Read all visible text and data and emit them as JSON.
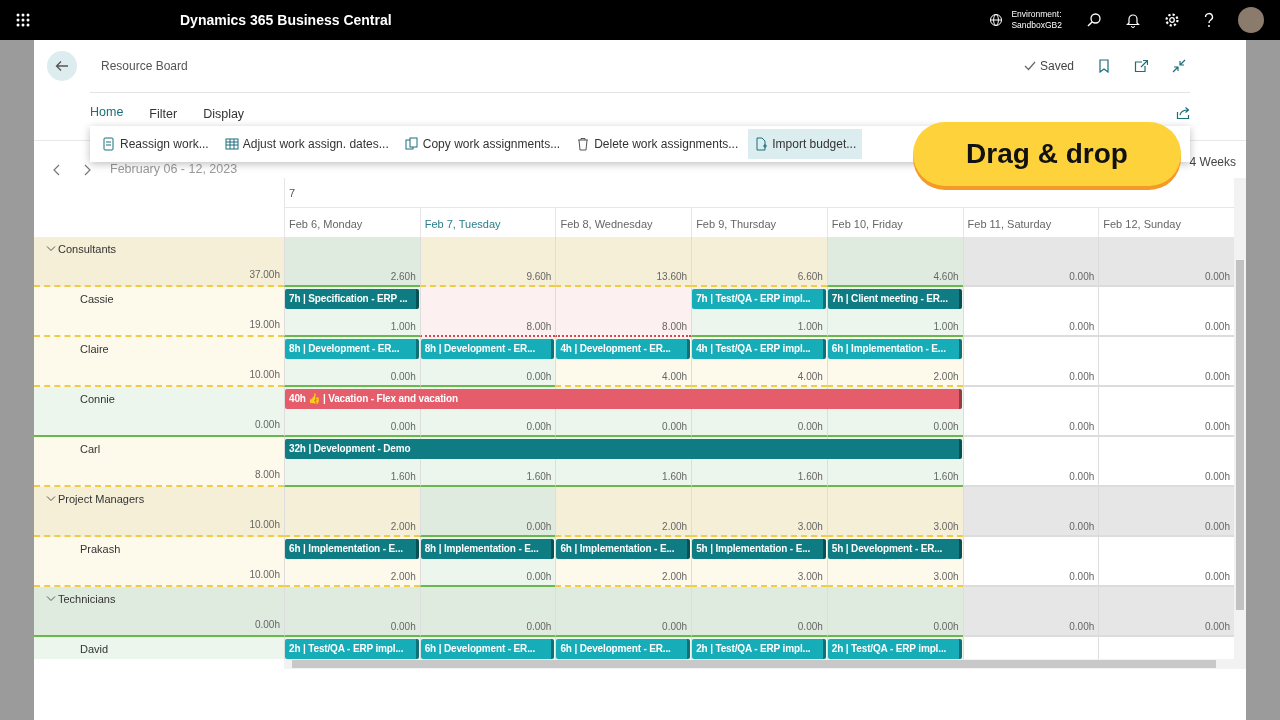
{
  "app": {
    "title": "Dynamics 365 Business Central",
    "environment_label": "Environment:",
    "environment_name": "SandboxGB2"
  },
  "page": {
    "title": "Resource Board",
    "saved": "Saved"
  },
  "tabs": [
    {
      "label": "Home",
      "selected": true
    },
    {
      "label": "Filter",
      "selected": false
    },
    {
      "label": "Display",
      "selected": false
    }
  ],
  "actions": [
    {
      "label": "Reassign work...",
      "kind": "reassign",
      "selected": false
    },
    {
      "label": "Adjust work assign. dates...",
      "kind": "calendar",
      "selected": false
    },
    {
      "label": "Copy work assignments...",
      "kind": "copy",
      "selected": false
    },
    {
      "label": "Delete work assignments...",
      "kind": "delete",
      "selected": false
    },
    {
      "label": "Import budget...",
      "kind": "import",
      "selected": true
    }
  ],
  "date_nav": {
    "range": "February 06 - 12, 2023",
    "view": "4 Weeks"
  },
  "callout": "Drag & drop",
  "board": {
    "week": "7",
    "days": [
      {
        "label": "Feb 6, Monday",
        "today": false
      },
      {
        "label": "Feb 7, Tuesday",
        "today": true
      },
      {
        "label": "Feb 8, Wednesday",
        "today": false
      },
      {
        "label": "Feb 9, Thursday",
        "today": false
      },
      {
        "label": "Feb 10, Friday",
        "today": false
      },
      {
        "label": "Feb 11, Saturday",
        "today": false
      },
      {
        "label": "Feb 12, Sunday",
        "today": false
      }
    ],
    "rows": [
      {
        "name": "Consultants",
        "kind": "group",
        "expanded": true,
        "total": "37.00h",
        "color": "#f0cb45",
        "cells": [
          {
            "hours": "2.60h",
            "kind": "full"
          },
          {
            "hours": "9.60h",
            "kind": "under"
          },
          {
            "hours": "13.60h",
            "kind": "under"
          },
          {
            "hours": "6.60h",
            "kind": "under"
          },
          {
            "hours": "4.60h",
            "kind": "full"
          },
          {
            "hours": "0.00h",
            "kind": "off"
          },
          {
            "hours": "0.00h",
            "kind": "off"
          }
        ]
      },
      {
        "name": "Cassie",
        "kind": "resource",
        "total": "19.00h",
        "color": "#f0cb45",
        "cells": [
          {
            "hours": "1.00h",
            "kind": "full",
            "booking": {
              "text": "7h | Specification - ERP ...",
              "color": "#0e7c82"
            }
          },
          {
            "hours": "8.00h",
            "kind": "over"
          },
          {
            "hours": "8.00h",
            "kind": "over"
          },
          {
            "hours": "1.00h",
            "kind": "full",
            "booking": {
              "text": "7h | Test/QA - ERP impl...",
              "color": "#17adb8"
            }
          },
          {
            "hours": "1.00h",
            "kind": "full",
            "booking": {
              "text": "7h | Client meeting - ER...",
              "color": "#0e7c82"
            }
          },
          {
            "hours": "0.00h",
            "kind": "off"
          },
          {
            "hours": "0.00h",
            "kind": "off"
          }
        ]
      },
      {
        "name": "Claire",
        "kind": "resource",
        "total": "10.00h",
        "color": "#f0cb45",
        "cells": [
          {
            "hours": "0.00h",
            "kind": "full",
            "booking": {
              "text": "8h | Development - ER...",
              "color": "#17adb8"
            }
          },
          {
            "hours": "0.00h",
            "kind": "full",
            "booking": {
              "text": "8h | Development - ER...",
              "color": "#17adb8"
            }
          },
          {
            "hours": "4.00h",
            "kind": "under",
            "booking": {
              "text": "4h | Development - ER...",
              "color": "#17adb8"
            }
          },
          {
            "hours": "4.00h",
            "kind": "under",
            "booking": {
              "text": "4h | Test/QA - ERP impl...",
              "color": "#17adb8"
            }
          },
          {
            "hours": "2.00h",
            "kind": "under",
            "booking": {
              "text": "6h | Implementation - E...",
              "color": "#17adb8"
            }
          },
          {
            "hours": "0.00h",
            "kind": "off"
          },
          {
            "hours": "0.00h",
            "kind": "off"
          }
        ]
      },
      {
        "name": "Connie",
        "kind": "resource",
        "total": "0.00h",
        "color": "#6ab64f",
        "cells": [
          {
            "hours": "0.00h",
            "kind": "full",
            "booking": {
              "text": "40h 👍 | Vacation - Flex and vacation",
              "color": "#e55c6b"
            }
          },
          {
            "hours": "0.00h",
            "kind": "full",
            "covered": true
          },
          {
            "hours": "0.00h",
            "kind": "full",
            "covered": true
          },
          {
            "hours": "0.00h",
            "kind": "full",
            "covered": true
          },
          {
            "hours": "0.00h",
            "kind": "full",
            "covered": true
          },
          {
            "hours": "0.00h",
            "kind": "off"
          },
          {
            "hours": "0.00h",
            "kind": "off"
          }
        ]
      },
      {
        "name": "Carl",
        "kind": "resource",
        "total": "8.00h",
        "color": "#f0cb45",
        "cells": [
          {
            "hours": "1.60h",
            "kind": "full",
            "booking": {
              "text": "32h | Development - Demo",
              "color": "#0e7c82"
            }
          },
          {
            "hours": "1.60h",
            "kind": "full",
            "covered": true
          },
          {
            "hours": "1.60h",
            "kind": "full",
            "covered": true
          },
          {
            "hours": "1.60h",
            "kind": "full",
            "covered": true
          },
          {
            "hours": "1.60h",
            "kind": "full",
            "covered": true
          },
          {
            "hours": "0.00h",
            "kind": "off"
          },
          {
            "hours": "0.00h",
            "kind": "off"
          }
        ]
      },
      {
        "name": "Project Managers",
        "kind": "group",
        "expanded": true,
        "total": "10.00h",
        "color": "#f0cb45",
        "cells": [
          {
            "hours": "2.00h",
            "kind": "under"
          },
          {
            "hours": "0.00h",
            "kind": "full"
          },
          {
            "hours": "2.00h",
            "kind": "under"
          },
          {
            "hours": "3.00h",
            "kind": "under"
          },
          {
            "hours": "3.00h",
            "kind": "under"
          },
          {
            "hours": "0.00h",
            "kind": "off"
          },
          {
            "hours": "0.00h",
            "kind": "off"
          }
        ]
      },
      {
        "name": "Prakash",
        "kind": "resource",
        "total": "10.00h",
        "color": "#f0cb45",
        "cells": [
          {
            "hours": "2.00h",
            "kind": "under",
            "booking": {
              "text": "6h | Implementation - E...",
              "color": "#0e7c82"
            }
          },
          {
            "hours": "0.00h",
            "kind": "full",
            "booking": {
              "text": "8h | Implementation - E...",
              "color": "#0e7c82"
            }
          },
          {
            "hours": "2.00h",
            "kind": "under",
            "booking": {
              "text": "6h | Implementation - E...",
              "color": "#0e7c82"
            }
          },
          {
            "hours": "3.00h",
            "kind": "under",
            "booking": {
              "text": "5h | Implementation - E...",
              "color": "#0e7c82"
            }
          },
          {
            "hours": "3.00h",
            "kind": "under",
            "booking": {
              "text": "5h | Development - ER...",
              "color": "#0e7c82"
            }
          },
          {
            "hours": "0.00h",
            "kind": "off"
          },
          {
            "hours": "0.00h",
            "kind": "off"
          }
        ]
      },
      {
        "name": "Technicians",
        "kind": "group",
        "expanded": true,
        "total": "0.00h",
        "color": "#6ab64f",
        "cells": [
          {
            "hours": "0.00h",
            "kind": "full"
          },
          {
            "hours": "0.00h",
            "kind": "full"
          },
          {
            "hours": "0.00h",
            "kind": "full"
          },
          {
            "hours": "0.00h",
            "kind": "full"
          },
          {
            "hours": "0.00h",
            "kind": "full"
          },
          {
            "hours": "0.00h",
            "kind": "off"
          },
          {
            "hours": "0.00h",
            "kind": "off"
          }
        ]
      },
      {
        "name": "David",
        "kind": "resource",
        "cells": [
          {
            "kind": "full",
            "booking": {
              "text": "2h | Test/QA - ERP impl...",
              "color": "#17adb8"
            }
          },
          {
            "kind": "full",
            "booking": {
              "text": "6h | Development - ER...",
              "color": "#17adb8"
            }
          },
          {
            "kind": "full",
            "booking": {
              "text": "6h | Development - ER...",
              "color": "#17adb8"
            }
          },
          {
            "kind": "full",
            "booking": {
              "text": "2h | Test/QA - ERP impl...",
              "color": "#17adb8"
            }
          },
          {
            "kind": "full",
            "booking": {
              "text": "2h | Test/QA - ERP impl...",
              "color": "#17adb8"
            }
          },
          {
            "kind": "off"
          },
          {
            "kind": "off"
          }
        ]
      }
    ]
  }
}
